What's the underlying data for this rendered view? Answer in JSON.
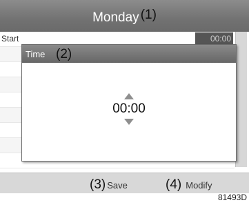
{
  "header": {
    "title": "Monday",
    "callout": "(1)"
  },
  "list": {
    "rows": [
      {
        "label": "Start",
        "value": "00:00"
      }
    ]
  },
  "dialog": {
    "title": "Time",
    "callout": "(2)",
    "value": "00:00"
  },
  "softkeys": {
    "left_callout": "(3)",
    "left_label": "Save",
    "right_callout": "(4)",
    "right_label": "Modify"
  },
  "figure_id": "81493D"
}
